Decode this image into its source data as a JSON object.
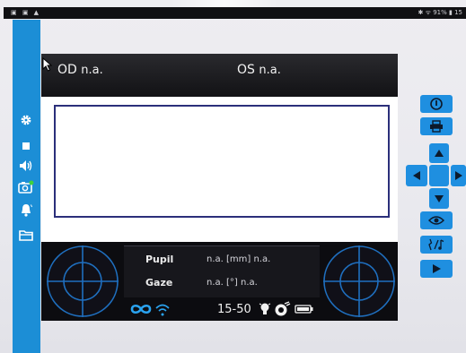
{
  "status_bar": {
    "left_icons": "▣ ▣ ▲",
    "right_text": "✱ ᯤ 91% ▮ 15"
  },
  "sidebar": {
    "items": [
      {
        "icon": "gear-icon"
      },
      {
        "icon": "stop-icon"
      },
      {
        "icon": "speaker-icon"
      },
      {
        "icon": "camera-icon"
      },
      {
        "icon": "bell-icon"
      },
      {
        "icon": "folder-icon"
      }
    ]
  },
  "header": {
    "od_label": "OD",
    "od_value": "n.a.",
    "os_label": "OS",
    "os_value": "n.a."
  },
  "measurements": {
    "pupil_label": "Pupil",
    "pupil_value": "n.a. [mm] n.a.",
    "gaze_label": "Gaze",
    "gaze_value": "n.a. [°] n.a."
  },
  "status_strip": {
    "range": "15-50",
    "icons": [
      "infinity-icon",
      "wifi-icon",
      "lightbulb-icon",
      "eye-check-icon",
      "battery-icon"
    ]
  },
  "controls": {
    "buttons": [
      "power-icon",
      "print-icon",
      "arrow-up-icon",
      "arrow-left-icon",
      "arrow-right-icon",
      "arrow-down-icon",
      "eye-icon",
      "audio-icon",
      "play-icon"
    ]
  },
  "colors": {
    "accent_blue": "#1c8ed6",
    "control_blue": "#1f8fe0",
    "frame_navy": "#2b2f7a",
    "reticle_blue": "#1f6fbf"
  }
}
